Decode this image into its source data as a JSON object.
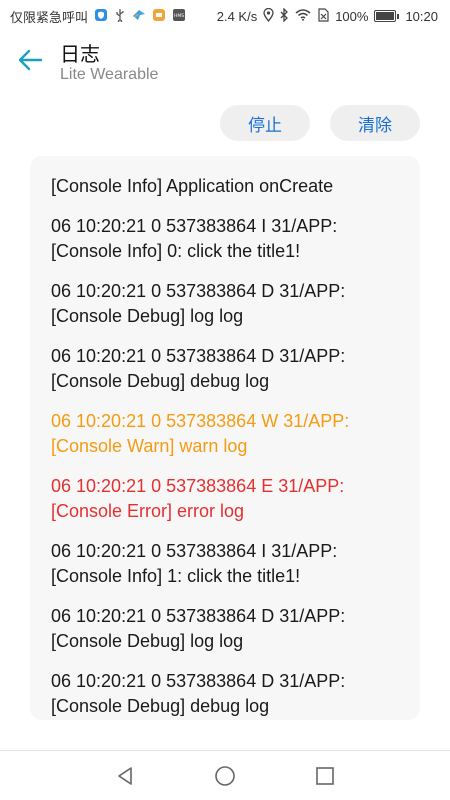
{
  "status_bar": {
    "carrier": "仅限紧急呼叫",
    "speed": "2.4 K/s",
    "battery": "100%",
    "time": "10:20",
    "icons": [
      "shield-icon",
      "usb-icon",
      "bird-icon",
      "app-icon",
      "hms-icon",
      "location-icon",
      "bluetooth-icon",
      "wifi-icon",
      "no-sim-icon",
      "battery-icon"
    ]
  },
  "app_bar": {
    "title": "日志",
    "subtitle": "Lite Wearable"
  },
  "actions": {
    "stop_label": "停止",
    "clear_label": "清除"
  },
  "colors": {
    "accent": "#1a6fd0",
    "back_arrow": "#1aa3b8",
    "warn": "#f39c12",
    "error": "#e53030",
    "panel_bg": "#f7f7f7"
  },
  "logs": [
    {
      "level": "info",
      "lines": [
        "[Console Info] Application onCreate"
      ]
    },
    {
      "level": "info",
      "lines": [
        "06 10:20:21 0 537383864 I 31/APP:",
        "[Console Info] 0: click the title1!"
      ]
    },
    {
      "level": "debug",
      "lines": [
        "06 10:20:21 0 537383864 D 31/APP:",
        "[Console Debug] log log"
      ]
    },
    {
      "level": "debug",
      "lines": [
        "06 10:20:21 0 537383864 D 31/APP:",
        "[Console Debug] debug log"
      ]
    },
    {
      "level": "warn",
      "lines": [
        "06 10:20:21 0 537383864 W 31/APP:",
        "[Console Warn] warn log"
      ]
    },
    {
      "level": "error",
      "lines": [
        "06 10:20:21 0 537383864 E 31/APP:",
        "[Console Error] error log"
      ]
    },
    {
      "level": "info",
      "lines": [
        "06 10:20:21 0 537383864 I 31/APP:",
        "[Console Info] 1: click the title1!"
      ]
    },
    {
      "level": "debug",
      "lines": [
        "06 10:20:21 0 537383864 D 31/APP:",
        "[Console Debug] log log"
      ]
    },
    {
      "level": "debug",
      "lines": [
        "06 10:20:21 0 537383864 D 31/APP:",
        "[Console Debug] debug log"
      ]
    }
  ]
}
